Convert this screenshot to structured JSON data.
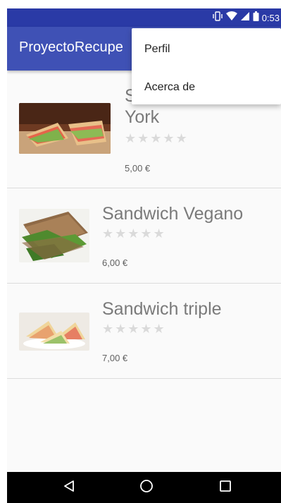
{
  "status_bar": {
    "time": "0:53",
    "icons": [
      "vibrate-icon",
      "wifi-icon",
      "signal-icon",
      "battery-icon"
    ]
  },
  "toolbar": {
    "title": "ProyectoRecupe"
  },
  "overflow_menu": {
    "items": [
      {
        "label": "Perfil"
      },
      {
        "label": "Acerca de"
      }
    ]
  },
  "products": [
    {
      "name_line1": "S",
      "name_line2": "York",
      "stars": "★★★★★",
      "rating": 0,
      "price": "5,00 €",
      "image": "sandwich-york-image"
    },
    {
      "name": "Sandwich Vegano",
      "stars": "★★★★★",
      "rating": 0,
      "price": "6,00 €",
      "image": "sandwich-vegano-image"
    },
    {
      "name": "Sandwich triple",
      "stars": "★★★★★",
      "rating": 0,
      "price": "7,00 €",
      "image": "sandwich-triple-image"
    }
  ],
  "nav_bar": {
    "buttons": [
      "back-icon",
      "home-icon",
      "recents-icon"
    ]
  },
  "colors": {
    "primary": "#3f51b5",
    "primary_dark": "#2a3aa6",
    "background": "#fafafa"
  }
}
